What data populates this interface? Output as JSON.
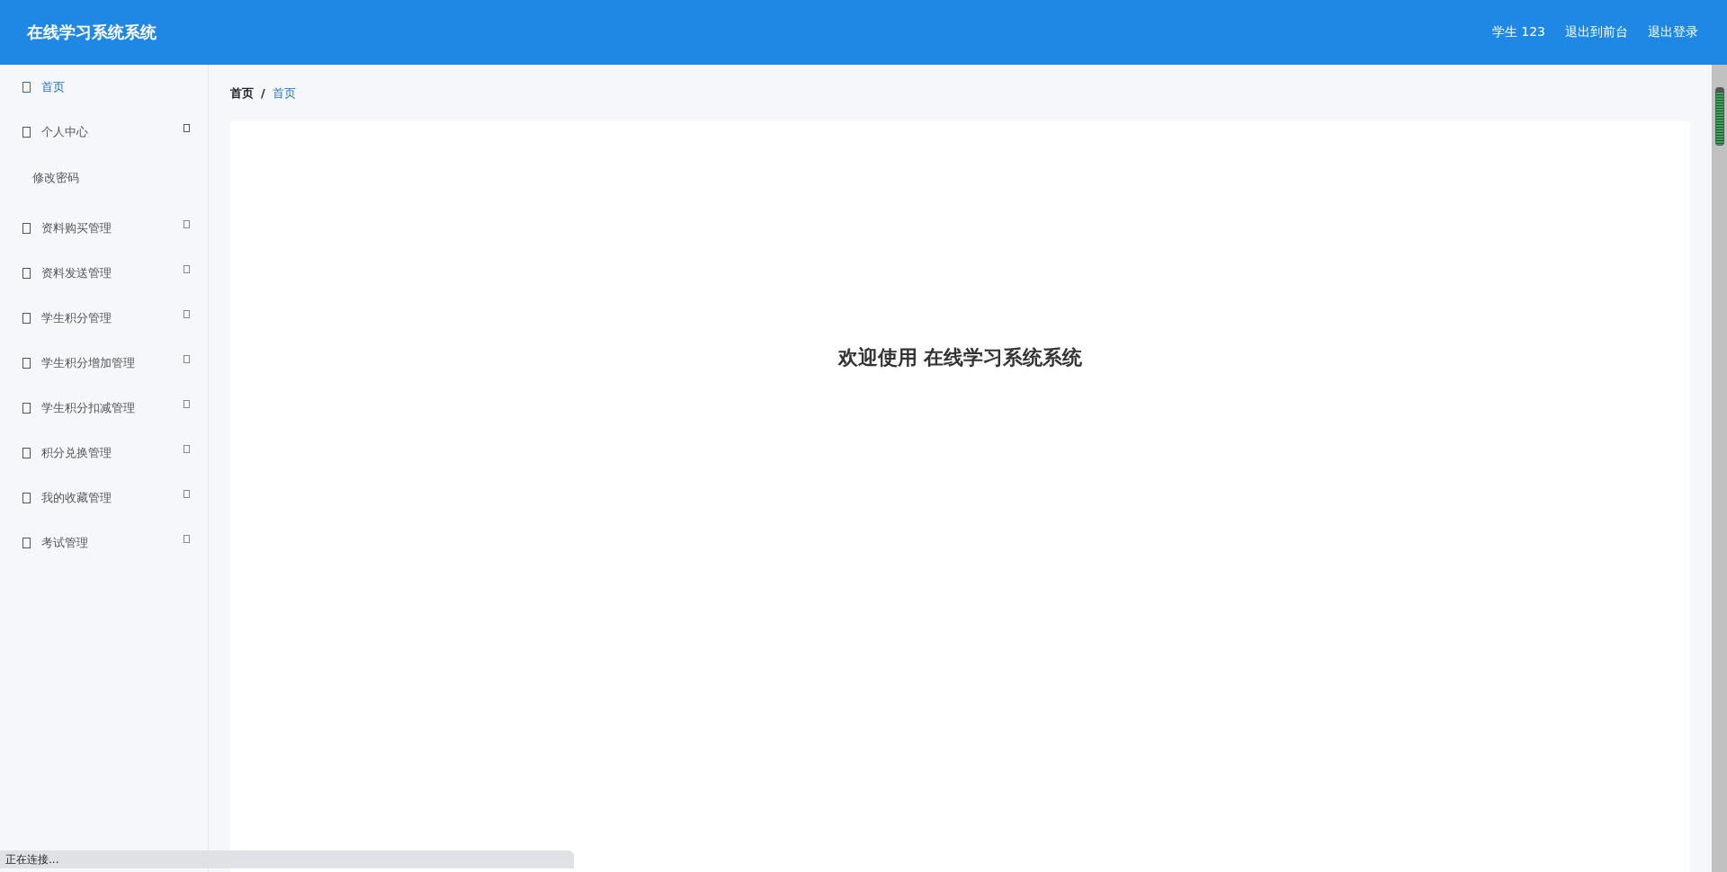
{
  "header": {
    "title": "在线学习系统系统",
    "user": "学生 123",
    "links": [
      "退出到前台",
      "退出登录"
    ]
  },
  "sidebar": {
    "items": [
      {
        "label": "首页",
        "kind": "link",
        "selected": true
      },
      {
        "label": "个人中心",
        "kind": "submenu",
        "selected": false,
        "expanded": true,
        "children": [
          {
            "label": "修改密码",
            "selected": false
          }
        ]
      },
      {
        "label": "资料购买管理",
        "kind": "submenu",
        "selected": false,
        "expanded": false
      },
      {
        "label": "资料发送管理",
        "kind": "submenu",
        "selected": false,
        "expanded": false
      },
      {
        "label": "学生积分管理",
        "kind": "submenu",
        "selected": false,
        "expanded": false
      },
      {
        "label": "学生积分增加管理",
        "kind": "submenu",
        "selected": false,
        "expanded": false
      },
      {
        "label": "学生积分扣减管理",
        "kind": "submenu",
        "selected": false,
        "expanded": false
      },
      {
        "label": "积分兑换管理",
        "kind": "submenu",
        "selected": false,
        "expanded": false
      },
      {
        "label": "我的收藏管理",
        "kind": "submenu",
        "selected": false,
        "expanded": false
      },
      {
        "label": "考试管理",
        "kind": "submenu",
        "selected": false,
        "expanded": false
      }
    ]
  },
  "breadcrumb": [
    {
      "label": "首页",
      "selected": false
    },
    {
      "label": "首页",
      "selected": true
    }
  ],
  "breadcrumb_separator": "/",
  "welcome": "欢迎使用 在线学习系统系统",
  "status_bar": "正在连接..."
}
